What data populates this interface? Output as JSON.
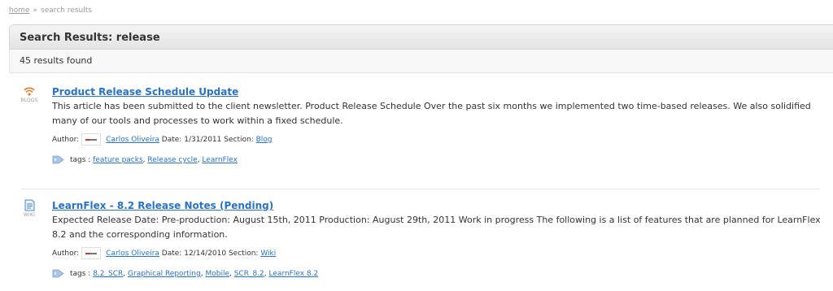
{
  "breadcrumb": {
    "home": "home",
    "separator": "»",
    "current": "search results"
  },
  "panel": {
    "title": "Search Results: release",
    "count": "45 results found"
  },
  "results": [
    {
      "type_icon": "rss-feed-icon",
      "type_label": "BLOGS",
      "title": "Product Release Schedule Update",
      "description": "This article has been submitted to the client newsletter. Product Release Schedule Over the past six months we implemented two time-based releases. We also solidified many of our tools and processes to work within a fixed schedule.",
      "author_label": "Author:",
      "author": "Carlos Oliveira",
      "date_label": "Date:",
      "date": "1/31/2011",
      "section_label": "Section:",
      "section": "Blog",
      "tags_label": "tags :",
      "tags": [
        "feature packs",
        "Release cycle",
        "LearnFlex"
      ]
    },
    {
      "type_icon": "wiki-document-icon",
      "type_label": "WIKI",
      "title": "LearnFlex - 8.2 Release Notes (Pending)",
      "description": "Expected Release Date: Pre-production: August 15th, 2011 Production: August 29th, 2011 Work in progress The following is a list of features that are planned for LearnFlex 8.2 and the corresponding information.",
      "author_label": "Author:",
      "author": "Carlos Oliveira",
      "date_label": "Date:",
      "date": "12/14/2010",
      "section_label": "Section:",
      "section": "Wiki",
      "tags_label": "tags :",
      "tags": [
        "8.2_SCR",
        "Graphical Reporting",
        "Mobile",
        "SCR_8.2",
        "LearnFlex 8.2"
      ]
    }
  ],
  "colors": {
    "link": "#2a72c3",
    "header_bg": "#e9e9e9",
    "text": "#333333"
  }
}
